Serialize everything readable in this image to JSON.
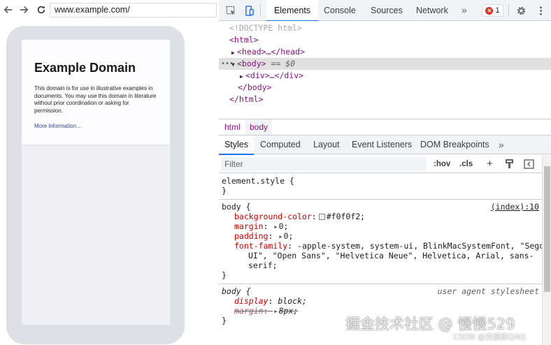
{
  "browser": {
    "url": "www.example.com/",
    "page": {
      "heading": "Example Domain",
      "body_text": "This domain is for use in illustrative examples in documents. You may use this domain in literature without prior coordination or asking for permission.",
      "link_text": "More information..."
    }
  },
  "devtools": {
    "tabs": [
      "Elements",
      "Console",
      "Sources",
      "Network"
    ],
    "active_tab": "Elements",
    "more_tabs": "»",
    "error_count": "1",
    "dom": {
      "doctype": "<!DOCTYPE html>",
      "html_open": "<html>",
      "head": "<head>…</head>",
      "body_open": "<body>",
      "selected_marker": "== $0",
      "div": "<div>…</div>",
      "body_close": "</body>",
      "html_close": "</html>"
    },
    "breadcrumbs": [
      "html",
      "body"
    ],
    "sub_tabs": [
      "Styles",
      "Computed",
      "Layout",
      "Event Listeners",
      "DOM Breakpoints"
    ],
    "sub_more": "»",
    "filter": {
      "placeholder": "Filter",
      "hov": ":hov",
      "cls": ".cls",
      "add": "+"
    },
    "styles": {
      "element_style": {
        "selector": "element.style {",
        "close": "}"
      },
      "body_rule": {
        "selector": "body {",
        "source": "(index):10",
        "props": [
          {
            "name": "background-color",
            "value": "#f0f0f2;"
          },
          {
            "name": "margin",
            "value": "0;"
          },
          {
            "name": "padding",
            "value": "0;"
          },
          {
            "name": "font-family",
            "value": "-apple-system, system-ui, BlinkMacSystemFont, \"Segoe"
          }
        ],
        "font_wrap_1": "UI\", \"Open Sans\", \"Helvetica Neue\", Helvetica, Arial, sans-",
        "font_wrap_2": "serif;",
        "close": "}"
      },
      "ua_rule": {
        "selector": "body {",
        "source": "user agent stylesheet",
        "props": [
          {
            "name": "display",
            "value": "block;"
          },
          {
            "name": "margin",
            "value": "8px;"
          }
        ],
        "close": "}"
      }
    },
    "colors": {
      "accent": "#1a73e8",
      "tag": "#881280",
      "prop": "#c80000",
      "swatch": "#f0f0f2"
    }
  },
  "watermark": {
    "main": "掘金技术社区 @ 慢慢529",
    "sub": "CSDN @杰振奕QAQ"
  }
}
